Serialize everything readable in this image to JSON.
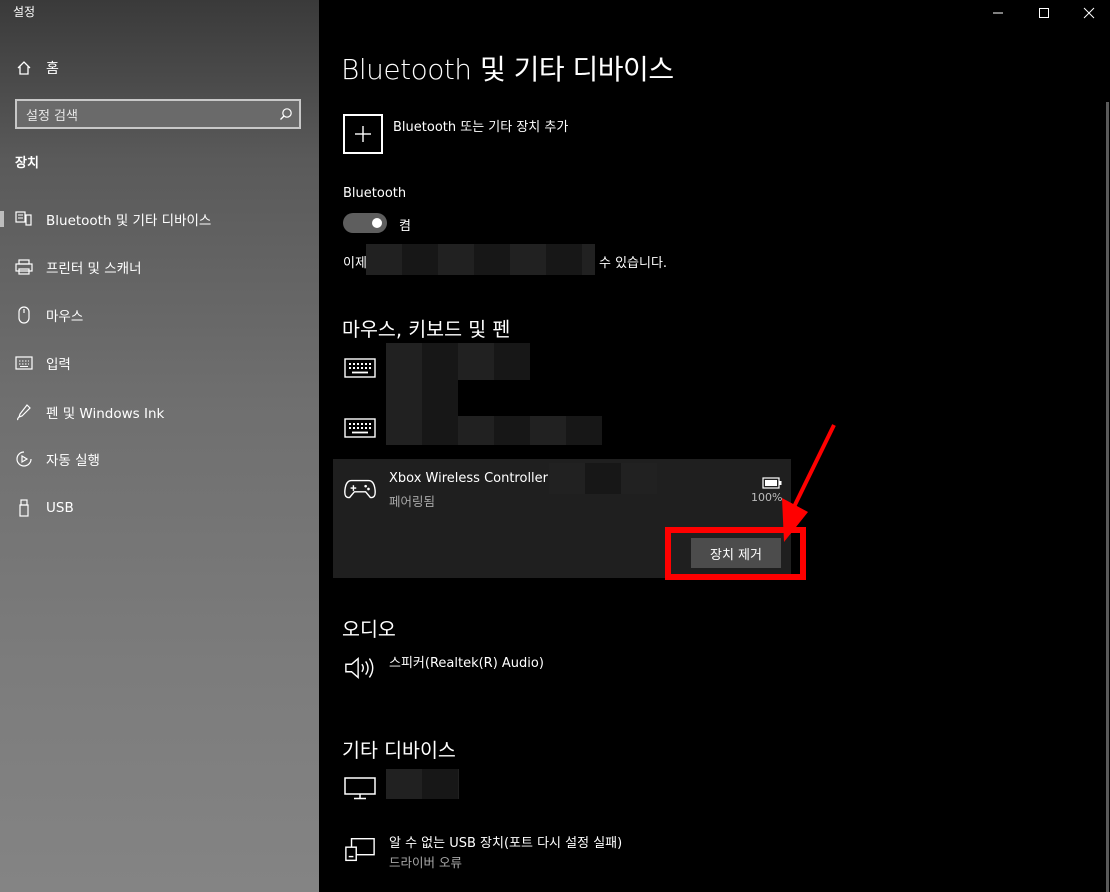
{
  "window": {
    "app_title": "설정",
    "minimize_symbol": "—",
    "maximize_symbol": "☐",
    "close_symbol": "✕"
  },
  "sidebar": {
    "home_label": "홈",
    "search_placeholder": "설정 검색",
    "section_title": "장치",
    "items": [
      {
        "label": "Bluetooth 및 기타 디바이스",
        "icon": "bluetooth-devices-icon",
        "active": true
      },
      {
        "label": "프린터 및 스캐너",
        "icon": "printer-icon"
      },
      {
        "label": "마우스",
        "icon": "mouse-icon"
      },
      {
        "label": "입력",
        "icon": "keyboard-icon"
      },
      {
        "label": "펜 및 Windows Ink",
        "icon": "pen-icon"
      },
      {
        "label": "자동 실행",
        "icon": "autoplay-icon"
      },
      {
        "label": "USB",
        "icon": "usb-icon"
      }
    ]
  },
  "main": {
    "title": "Bluetooth 및 기타 디바이스",
    "add_device_label": "Bluetooth 또는 기타 장치 추가",
    "bluetooth": {
      "label": "Bluetooth",
      "state_label": "켬",
      "discoverable_prefix": "이제",
      "discoverable_suffix": "수 있습니다."
    },
    "mice_section": {
      "title": "마우스, 키보드 및 펜",
      "controller": {
        "name": "Xbox Wireless Controller",
        "status": "페어링됨",
        "battery": "100%",
        "remove_button": "장치 제거"
      }
    },
    "audio_section": {
      "title": "오디오",
      "speaker_label": "스피커(Realtek(R) Audio)"
    },
    "other_section": {
      "title": "기타 디바이스",
      "usb_error_label": "알 수 없는 USB 장치(포트 다시 설정 실패)",
      "usb_error_sub": "드라이버 오류"
    }
  },
  "colors": {
    "highlight": "#ff0000",
    "arrow": "#ff0000",
    "background": "#000000"
  }
}
